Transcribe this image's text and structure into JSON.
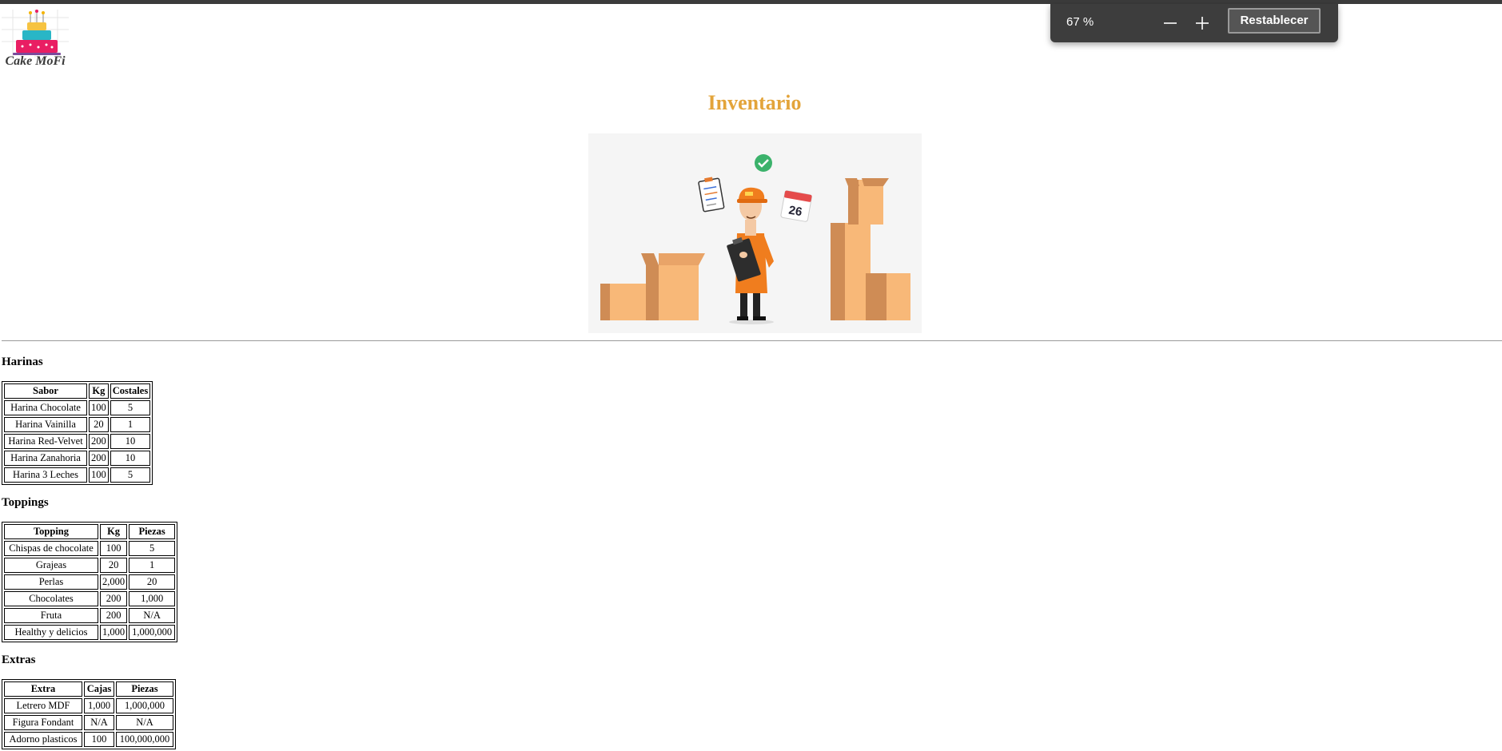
{
  "brand": {
    "logo_text": "Cake MoFi"
  },
  "page": {
    "title": "Inventario"
  },
  "zoom": {
    "level": "67 %",
    "reset_label": "Restablecer",
    "minus_icon": "minus-icon",
    "plus_icon": "plus-icon"
  },
  "hero": {
    "calendar_day": "26"
  },
  "sections": [
    {
      "title": "Harinas",
      "headers": [
        "Sabor",
        "Kg",
        "Costales"
      ],
      "rows": [
        [
          "Harina Chocolate",
          "100",
          "5"
        ],
        [
          "Harina Vainilla",
          "20",
          "1"
        ],
        [
          "Harina Red-Velvet",
          "200",
          "10"
        ],
        [
          "Harina Zanahoria",
          "200",
          "10"
        ],
        [
          "Harina 3 Leches",
          "100",
          "5"
        ]
      ]
    },
    {
      "title": "Toppings",
      "headers": [
        "Topping",
        "Kg",
        "Piezas"
      ],
      "rows": [
        [
          "Chispas de chocolate",
          "100",
          "5"
        ],
        [
          "Grajeas",
          "20",
          "1"
        ],
        [
          "Perlas",
          "2,000",
          "20"
        ],
        [
          "Chocolates",
          "200",
          "1,000"
        ],
        [
          "Fruta",
          "200",
          "N/A"
        ],
        [
          "Healthy y delicios",
          "1,000",
          "1,000,000"
        ]
      ]
    },
    {
      "title": "Extras",
      "headers": [
        "Extra",
        "Cajas",
        "Piezas"
      ],
      "rows": [
        [
          "Letrero MDF",
          "1,000",
          "1,000,000"
        ],
        [
          "Figura Fondant",
          "N/A",
          "N/A"
        ],
        [
          "Adorno plasticos",
          "100",
          "100,000,000"
        ]
      ]
    }
  ]
}
